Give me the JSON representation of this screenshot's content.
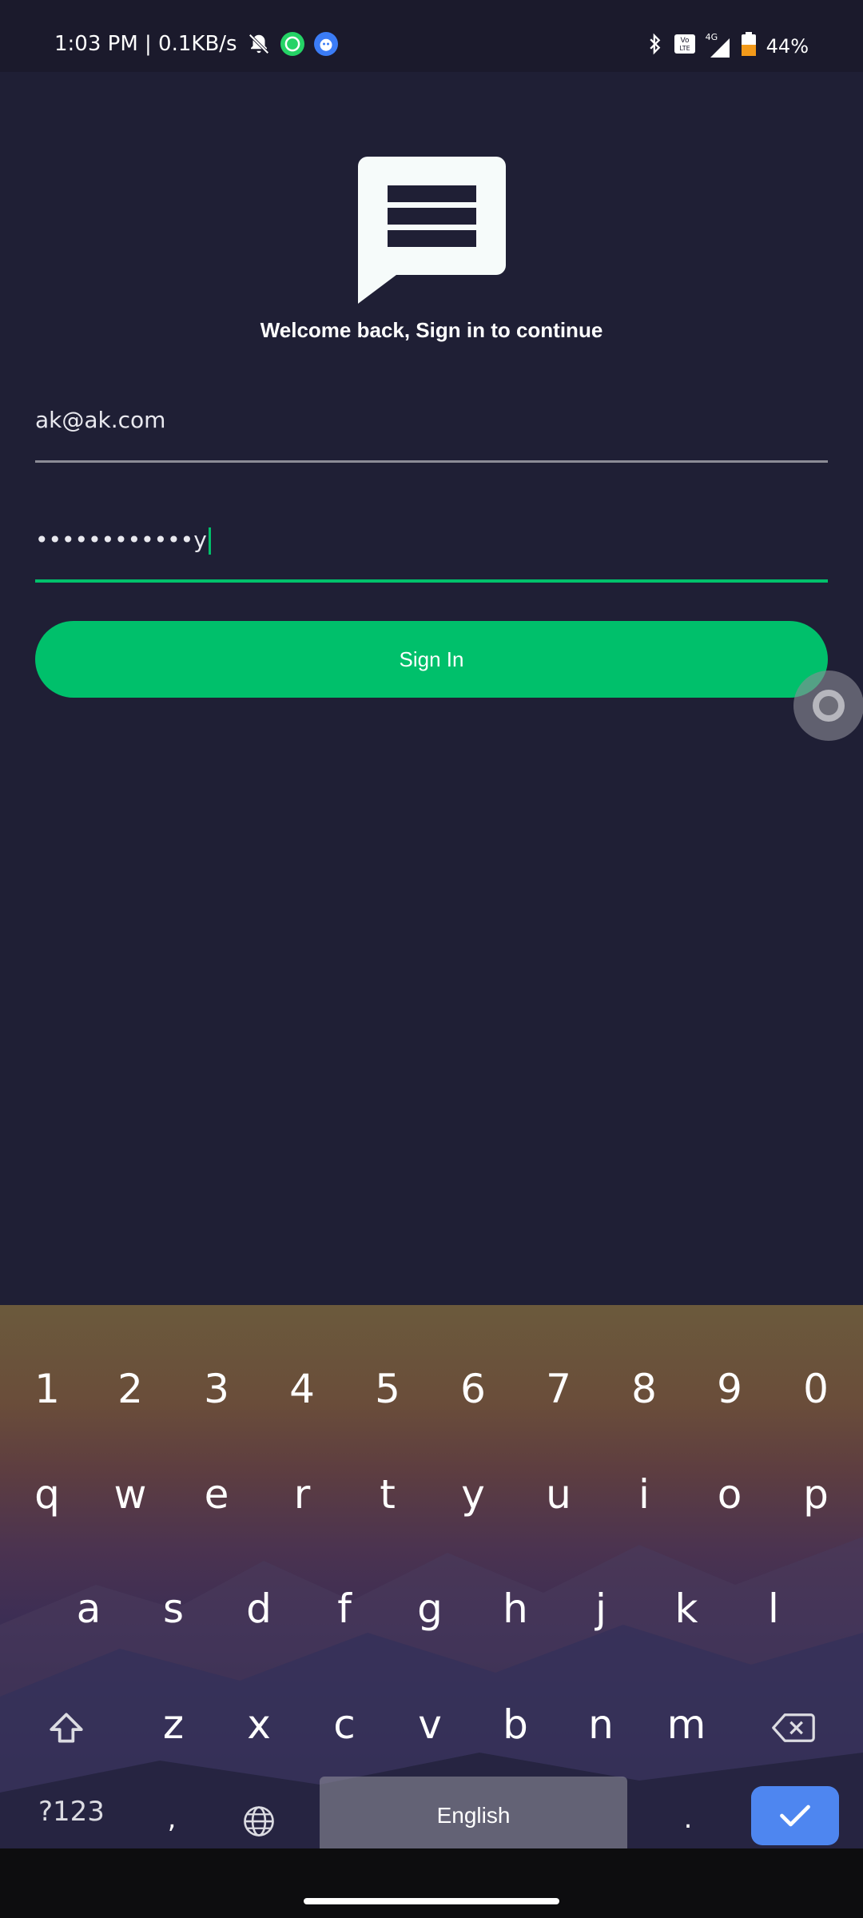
{
  "status_bar": {
    "time_and_speed": "1:03 PM | 0.1KB/s",
    "network_label": "4G",
    "battery_percent": "44%"
  },
  "app": {
    "welcome_text": "Welcome back, Sign in to continue",
    "email_value": "ak@ak.com",
    "password_masked": "••••••••••••y",
    "sign_in_label": "Sign In",
    "accent_color": "#00c06b",
    "background_color": "#1f1f35"
  },
  "keyboard": {
    "number_row": [
      "1",
      "2",
      "3",
      "4",
      "5",
      "6",
      "7",
      "8",
      "9",
      "0"
    ],
    "row_q": [
      "q",
      "w",
      "e",
      "r",
      "t",
      "y",
      "u",
      "i",
      "o",
      "p"
    ],
    "row_a": [
      "a",
      "s",
      "d",
      "f",
      "g",
      "h",
      "j",
      "k",
      "l"
    ],
    "row_z": [
      "z",
      "x",
      "c",
      "v",
      "b",
      "n",
      "m"
    ],
    "symbols_label": "?123",
    "comma_label": ",",
    "space_label": "English",
    "period_label": "."
  }
}
